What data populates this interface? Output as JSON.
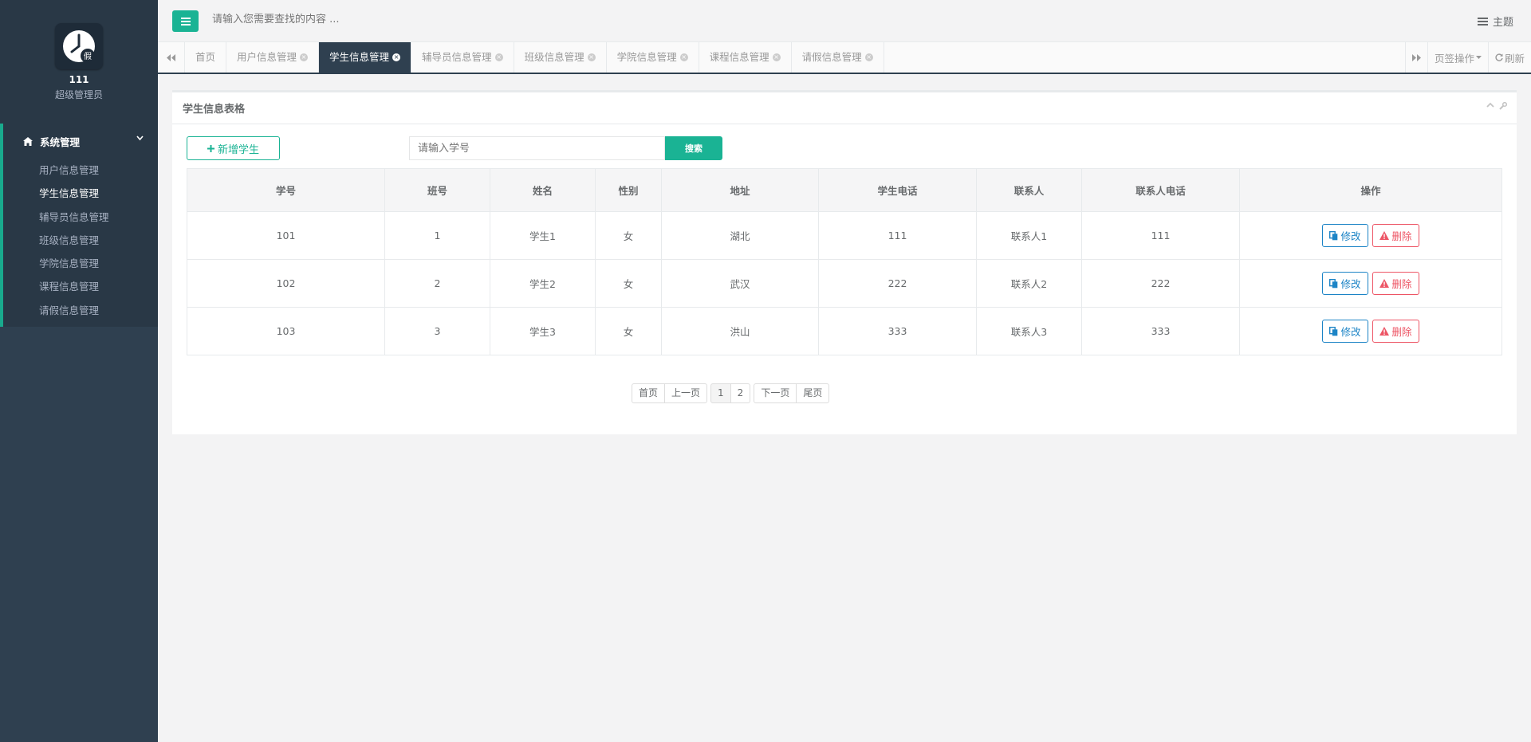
{
  "profile": {
    "name": "111",
    "role": "超级管理员",
    "logo_glyph": "假"
  },
  "sidebar": {
    "group_label": "系统管理",
    "items": [
      {
        "label": "用户信息管理"
      },
      {
        "label": "学生信息管理"
      },
      {
        "label": "辅导员信息管理"
      },
      {
        "label": "班级信息管理"
      },
      {
        "label": "学院信息管理"
      },
      {
        "label": "课程信息管理"
      },
      {
        "label": "请假信息管理"
      }
    ]
  },
  "topbar": {
    "search_placeholder": "请输入您需要查找的内容 ...",
    "theme_label": "主题"
  },
  "tabs": [
    {
      "label": "首页"
    },
    {
      "label": "用户信息管理"
    },
    {
      "label": "学生信息管理"
    },
    {
      "label": "辅导员信息管理"
    },
    {
      "label": "班级信息管理"
    },
    {
      "label": "学院信息管理"
    },
    {
      "label": "课程信息管理"
    },
    {
      "label": "请假信息管理"
    }
  ],
  "tab_actions": {
    "page_ops": "页签操作",
    "refresh": "刷新"
  },
  "panel": {
    "title": "学生信息表格",
    "add_label": "新增学生",
    "search_placeholder": "请输入学号",
    "search_label": "搜索"
  },
  "table": {
    "headers": [
      "学号",
      "班号",
      "姓名",
      "性别",
      "地址",
      "学生电话",
      "联系人",
      "联系人电话",
      "操作"
    ],
    "rows": [
      [
        "101",
        "1",
        "学生1",
        "女",
        "湖北",
        "111",
        "联系人1",
        "111"
      ],
      [
        "102",
        "2",
        "学生2",
        "女",
        "武汉",
        "222",
        "联系人2",
        "222"
      ],
      [
        "103",
        "3",
        "学生3",
        "女",
        "洪山",
        "333",
        "联系人3",
        "333"
      ]
    ],
    "edit_label": "修改",
    "delete_label": "删除"
  },
  "pager": {
    "first": "首页",
    "prev": "上一页",
    "p1": "1",
    "p2": "2",
    "next": "下一页",
    "last": "尾页"
  },
  "colors": {
    "sidebar": "#2f4050",
    "accent": "#1ab394",
    "edit": "#1c84c6",
    "delete": "#ed5565"
  }
}
